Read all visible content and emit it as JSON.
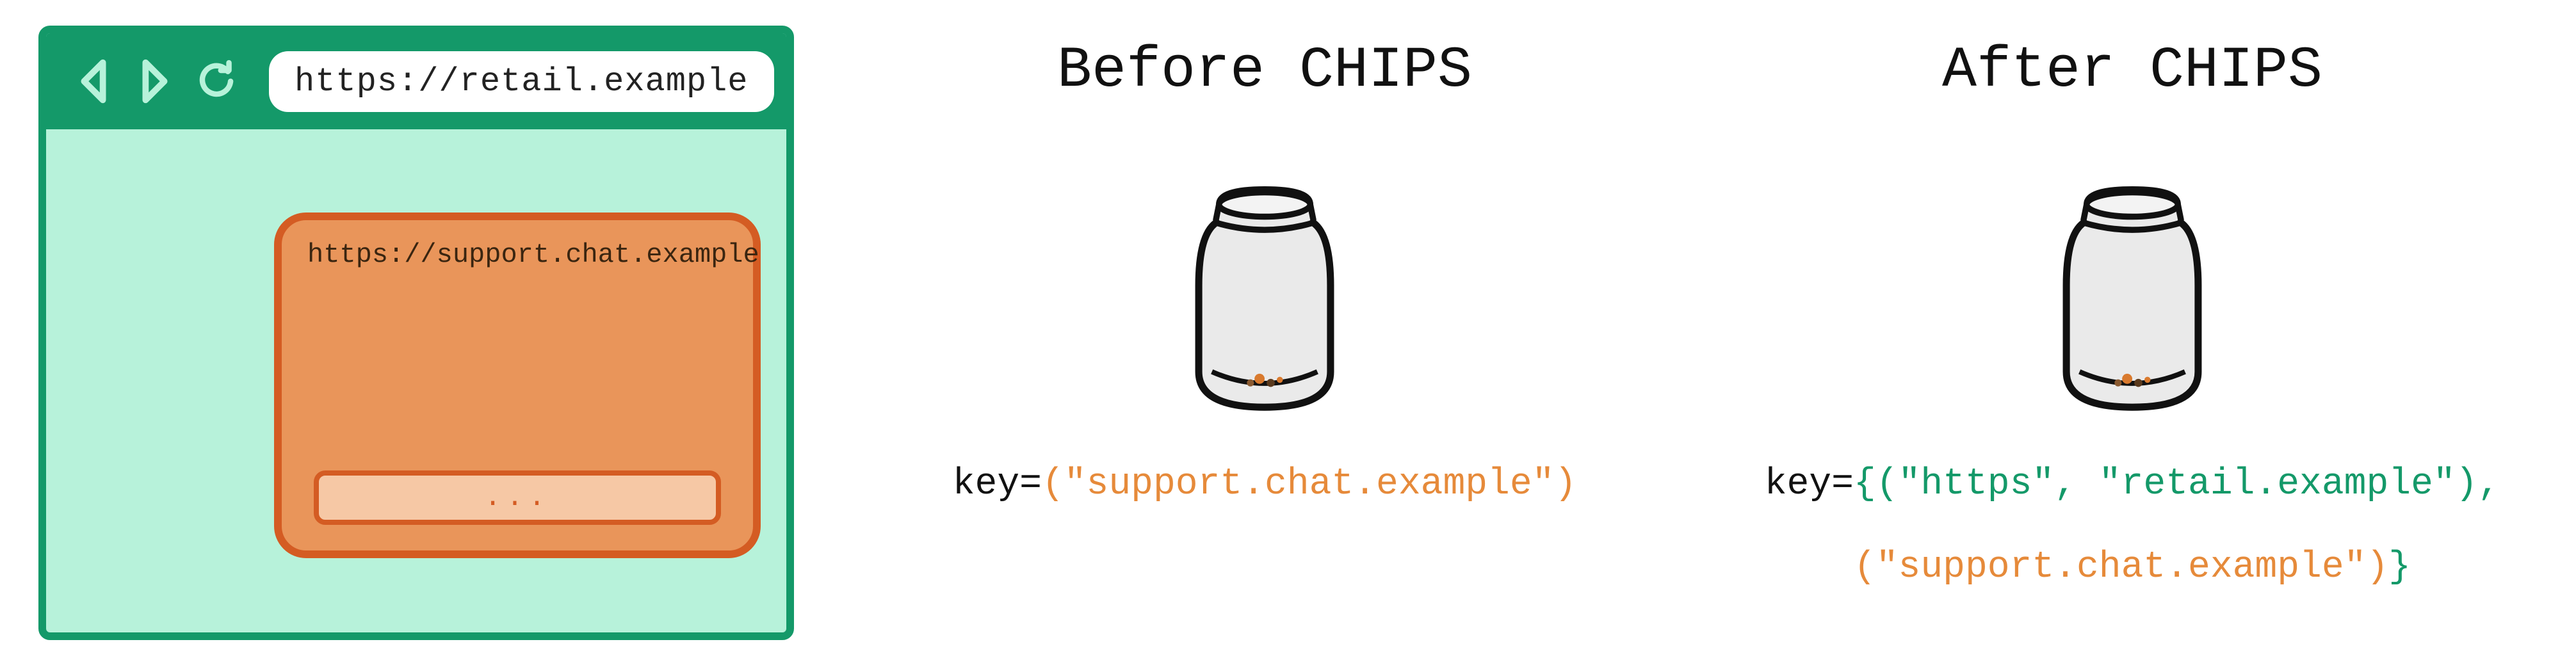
{
  "browser": {
    "url": "https://retail.example",
    "embedded_url": "https://support.chat.example",
    "chat_placeholder": "..."
  },
  "before": {
    "title": "Before CHIPS",
    "key_prefix": "key=",
    "key_value": "(\"support.chat.example\")"
  },
  "after": {
    "title": "After CHIPS",
    "key_prefix": "key=",
    "brace_open": "{",
    "tuple1": "(\"https\", \"retail.example\"),",
    "tuple2": "(\"support.chat.example\")",
    "brace_close": "}"
  }
}
